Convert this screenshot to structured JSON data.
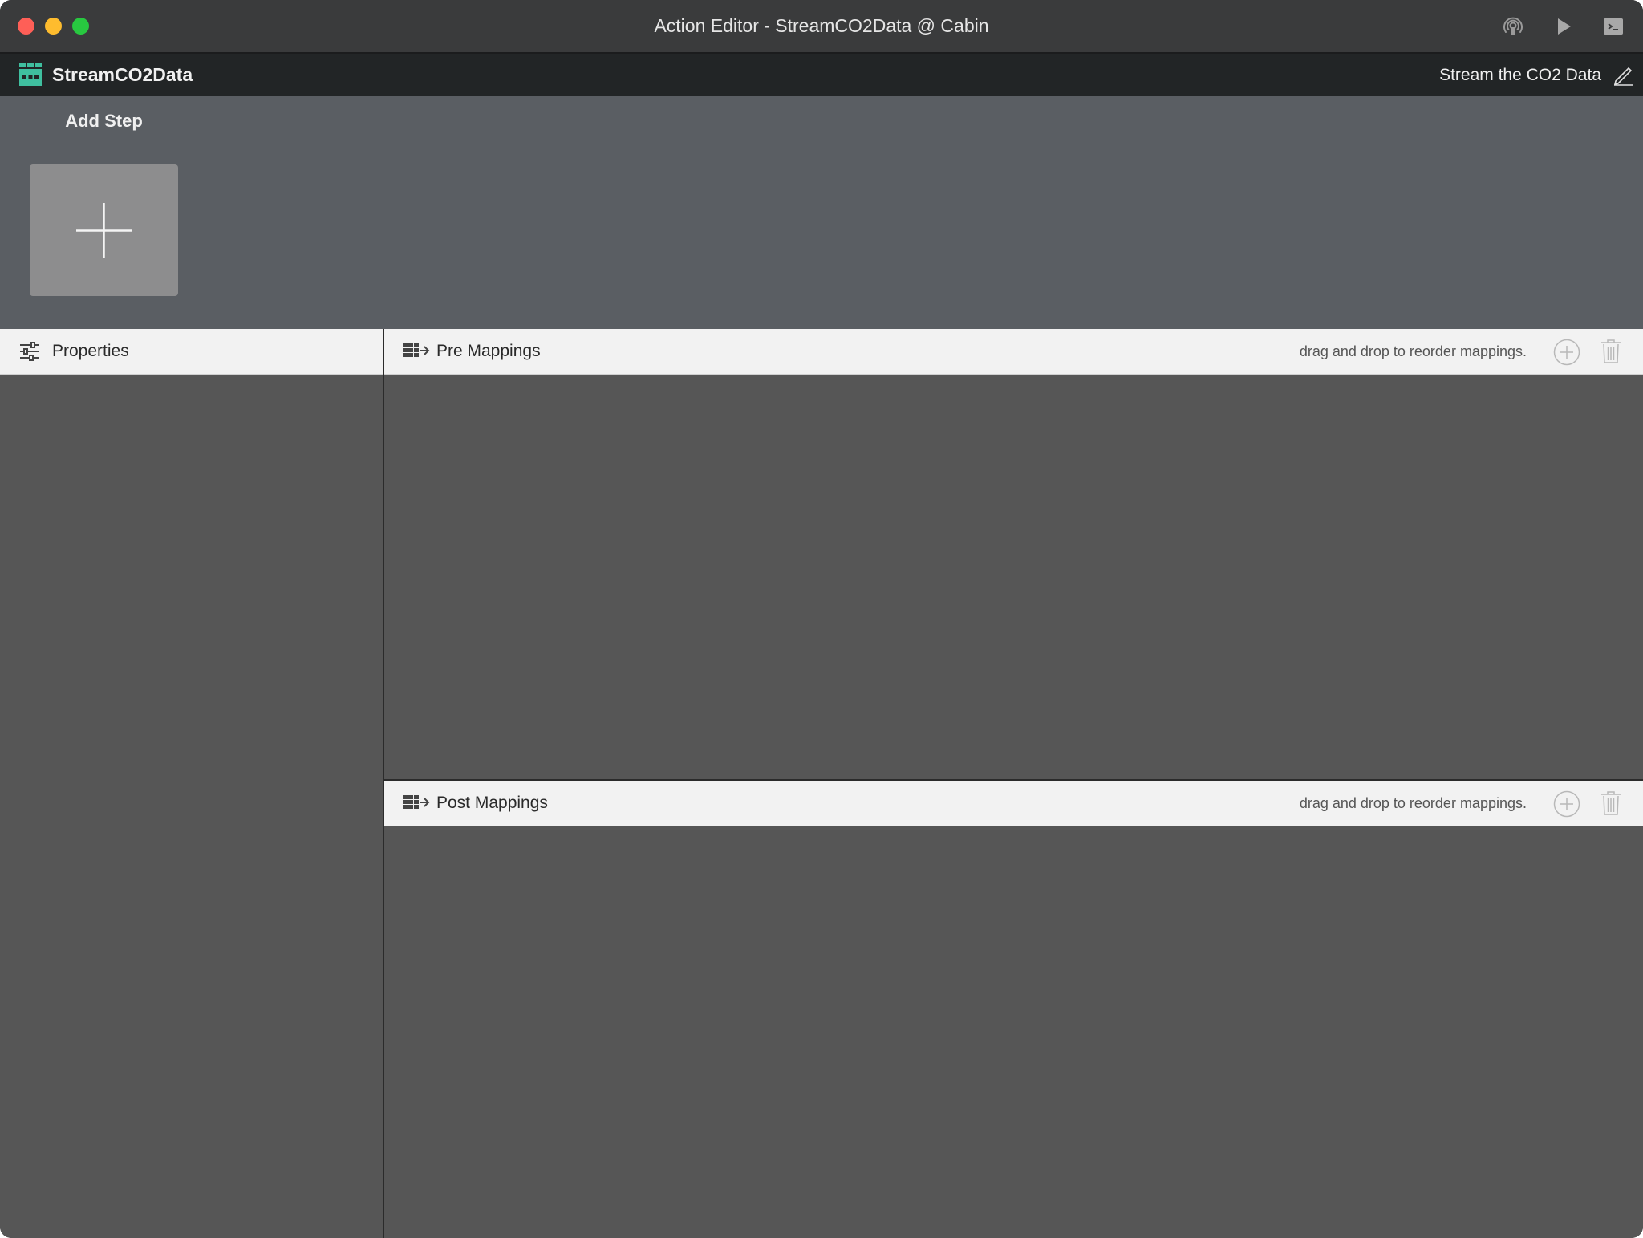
{
  "window": {
    "title": "Action Editor - StreamCO2Data @ Cabin"
  },
  "header": {
    "action_name": "StreamCO2Data",
    "description": "Stream the CO2 Data"
  },
  "steps": {
    "add_step_label": "Add Step"
  },
  "properties": {
    "title": "Properties"
  },
  "pre_mappings": {
    "title": "Pre Mappings",
    "hint": "drag and drop to reorder mappings."
  },
  "post_mappings": {
    "title": "Post Mappings",
    "hint": "drag and drop to reorder mappings."
  },
  "icons": {
    "traffic": [
      "close-button",
      "minimize-button",
      "maximize-button"
    ],
    "titlebar": [
      "stream-icon",
      "play-icon",
      "console-icon"
    ],
    "app": "action-icon",
    "edit": "pencil-icon",
    "mapping_actions": [
      "add-circle-icon",
      "trash-icon"
    ]
  },
  "colors": {
    "accent": "#3fbf9f",
    "titlebar": "#3a3b3c",
    "headerbar": "#222526",
    "steps_area": "#5a5e63",
    "panel_body": "#565656",
    "panel_header": "#f2f2f2"
  }
}
